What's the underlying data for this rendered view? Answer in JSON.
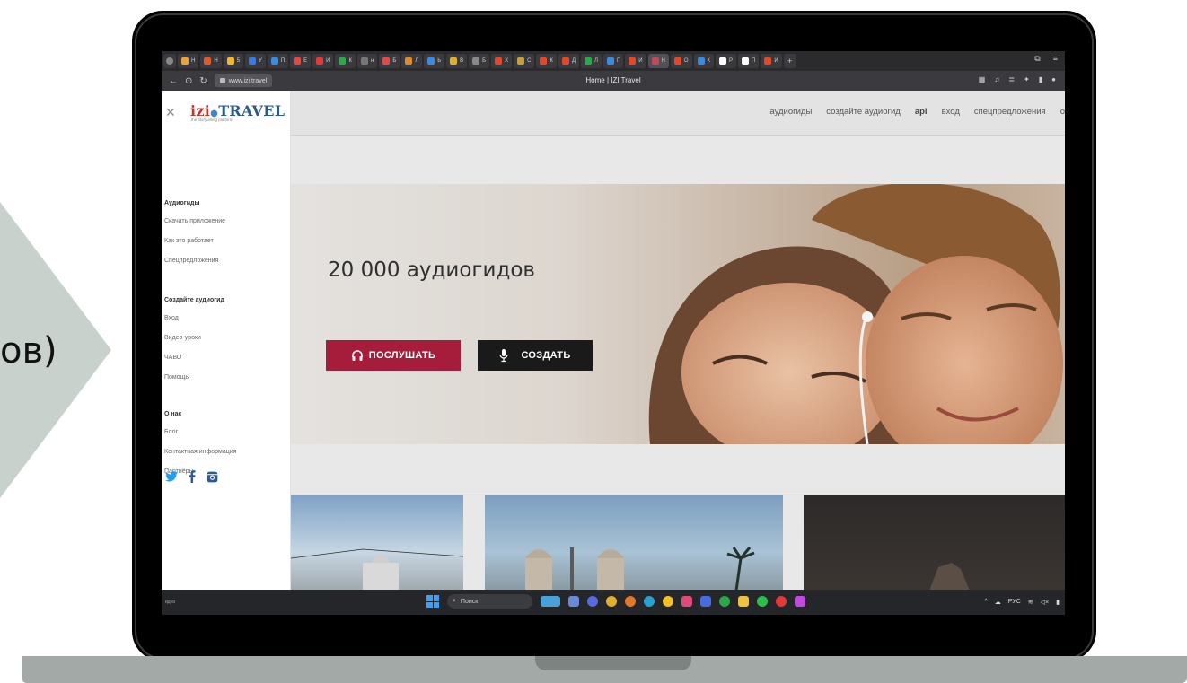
{
  "slide": {
    "partial_text": "ов)"
  },
  "browser": {
    "tabs": [
      {
        "label": "Н",
        "color": "#e8a33a"
      },
      {
        "label": "Н",
        "color": "#e05a2a"
      },
      {
        "label": "5",
        "color": "#f2b632"
      },
      {
        "label": "У",
        "color": "#3a7ae0"
      },
      {
        "label": "П",
        "color": "#3a8ae0"
      },
      {
        "label": "Е",
        "color": "#e04a4a"
      },
      {
        "label": "И",
        "color": "#e03a3a"
      },
      {
        "label": "К",
        "color": "#2aa84a"
      },
      {
        "label": "н",
        "color": "#777777"
      },
      {
        "label": "Б",
        "color": "#e04a4a"
      },
      {
        "label": "Л",
        "color": "#e08a2a"
      },
      {
        "label": "Ь",
        "color": "#3a8ae0"
      },
      {
        "label": "В",
        "color": "#e0b02a"
      },
      {
        "label": "Б",
        "color": "#888888"
      },
      {
        "label": "Х",
        "color": "#e04a2a"
      },
      {
        "label": "С",
        "color": "#c0a040"
      },
      {
        "label": "К",
        "color": "#e04a2a"
      },
      {
        "label": "Д",
        "color": "#e04a2a"
      },
      {
        "label": "Л",
        "color": "#2aa84a"
      },
      {
        "label": "Г",
        "color": "#3a8ae0"
      },
      {
        "label": "И",
        "color": "#e04a2a"
      },
      {
        "label": "Н",
        "color": "#c04a5a"
      },
      {
        "label": "О",
        "color": "#e04a2a"
      },
      {
        "label": "К",
        "color": "#3a8ae0"
      },
      {
        "label": "Р",
        "color": "#ffffff"
      },
      {
        "label": "П",
        "color": "#ffffff"
      },
      {
        "label": "И",
        "color": "#e04a2a"
      }
    ],
    "active_tab_index": 21,
    "url": "www.izi.travel",
    "page_title": "Home | IZI Travel"
  },
  "site": {
    "logo_main": "TRAVEL",
    "logo_prefix": "izi",
    "logo_tagline": "the storytelling platform",
    "nav": [
      {
        "label": "аудиогиды",
        "bold": false
      },
      {
        "label": "создайте аудиогид",
        "bold": false
      },
      {
        "label": "api",
        "bold": true
      },
      {
        "label": "вход",
        "bold": false
      },
      {
        "label": "спецпредложения",
        "bold": false
      },
      {
        "label": "о",
        "bold": false
      }
    ],
    "hero": {
      "title": "20 000 аудиогидов",
      "listen_button": "ПОСЛУШАТЬ",
      "create_button": "СОЗДАТЬ"
    },
    "sidebar": {
      "groups": [
        {
          "heading": "Аудиогиды",
          "links": [
            "Скачать приложение",
            "Как это работает",
            "Спецпредложения"
          ]
        },
        {
          "heading": "Создайте аудиогид",
          "links": [
            "Вход",
            "Видео-уроки",
            "ЧАВО",
            "Помощь"
          ]
        },
        {
          "heading": "О нас",
          "links": [
            "Блог",
            "Контактная информация",
            "Партнёры"
          ]
        }
      ]
    }
  },
  "taskbar": {
    "left_text": "идно",
    "search_placeholder": "Поиск",
    "language": "РУС"
  }
}
